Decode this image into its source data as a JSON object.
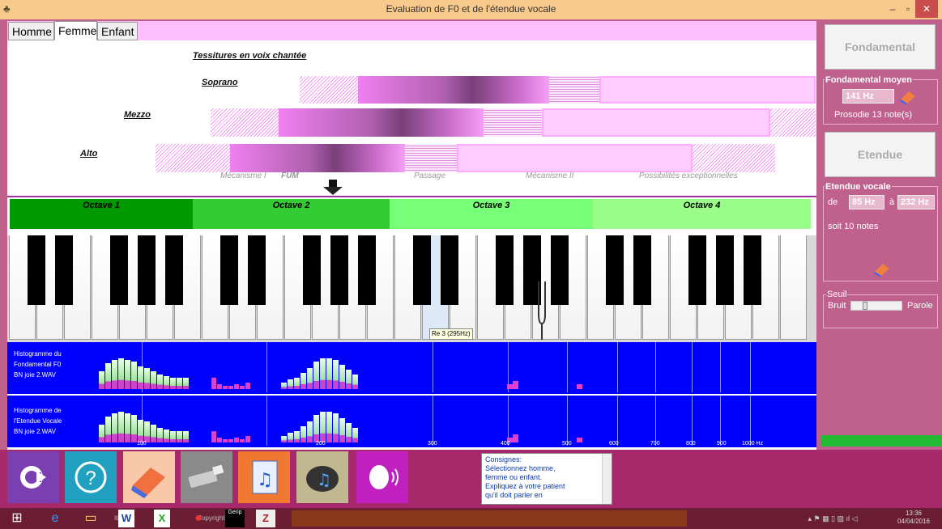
{
  "window": {
    "title": "Evaluation de F0 et de l'étendue vocale",
    "icon": "app-icon",
    "min": "–",
    "max": "▫",
    "close": "✕"
  },
  "tabs": [
    {
      "label": "Homme"
    },
    {
      "label": "Femme"
    },
    {
      "label": "Enfant"
    }
  ],
  "ranges": {
    "title": "Tessitures en voix chantée",
    "soprano": "Soprano",
    "mezzo": "Mezzo",
    "alto": "Alto",
    "labels": {
      "mech1": "Mécanisme I",
      "fum": "FUM",
      "passage": "Passage",
      "mech2": "Mécanisme II",
      "poss": "Possibilités exceptionnelles"
    }
  },
  "octaves": [
    {
      "label": "Octave 1",
      "color": "#00aa00"
    },
    {
      "label": "Octave 2",
      "color": "#33cc33"
    },
    {
      "label": "Octave 3",
      "color": "#66ff66"
    },
    {
      "label": "Octave 4",
      "color": "#99ff99"
    }
  ],
  "piano": {
    "tooltip": "Re 3 (295Hz)"
  },
  "hist1": {
    "l1": "Histogramme du",
    "l2": "Fondamental F0",
    "l3": "BN joie 2.WAV"
  },
  "hist2": {
    "l1": "Histogramme de",
    "l2": "l'Etendue Vocale",
    "l3": "BN joie 2.WAV"
  },
  "axis": [
    "100",
    "200",
    "300",
    "400",
    "500",
    "600",
    "700",
    "800",
    "900",
    "1000 Hz"
  ],
  "right": {
    "fond_btn": "Fondamental",
    "fond_group": "Fondamental moyen",
    "fond_val": "141 Hz",
    "prosodie": "Prosodie 13 note(s)",
    "etendue_btn": "Etendue",
    "et_group": "Etendue vocale",
    "de": "de",
    "a": "à",
    "min": "85 Hz",
    "max": "232 Hz",
    "soit": "soit 10 notes",
    "seuil": "Seuil",
    "bruit": "Bruit",
    "parole": "Parole"
  },
  "consignes": {
    "l1": "Consignes:",
    "l2": "Sélectionnez homme,",
    "l3": "femme ou enfant.",
    "l4": "Expliquez à votre patient",
    "l5": "qu'il doit parler en"
  },
  "taskbar": {
    "item1": "ition : 1",
    "item2": "Copyright : GI",
    "item3": "Gerip",
    "time": "13:36",
    "date": "04/04/2016"
  }
}
